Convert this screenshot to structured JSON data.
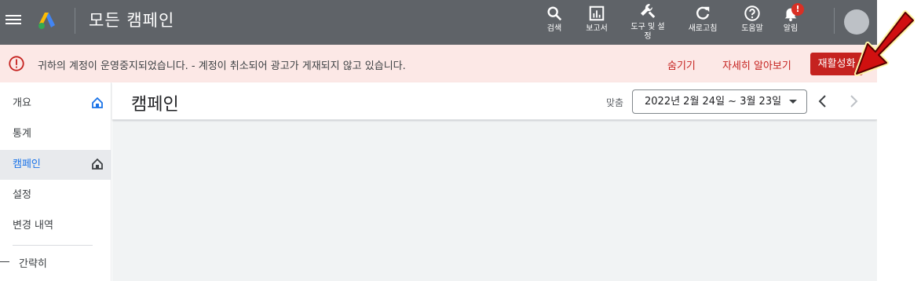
{
  "topbar": {
    "menu_icon": "hamburger-menu-icon",
    "logo_icon": "google-ads-logo-icon",
    "title": "모든 캠페인",
    "tools": [
      {
        "label": "검색",
        "icon": "search-icon"
      },
      {
        "label": "보고서",
        "icon": "reports-icon"
      },
      {
        "label": "도구 및 설",
        "label2": "정",
        "icon": "wrench-icon"
      },
      {
        "label": "새로고침",
        "icon": "refresh-icon"
      },
      {
        "label": "도움말",
        "icon": "help-icon"
      },
      {
        "label": "알림",
        "icon": "bell-icon",
        "badge": "!"
      }
    ],
    "bg_color": "#5f6368"
  },
  "alert": {
    "icon": "error-icon",
    "message": "귀하의 계정이 운영중지되었습니다. - 계정이 취소되어 광고가 게재되지 않고 있습니다.",
    "hide_label": "숨기기",
    "learn_more_label": "자세히 알아보기",
    "reactivate_label": "재활성화",
    "bg_color": "#fce8e6",
    "accent_color": "#c5221f"
  },
  "sidebar": {
    "items": [
      {
        "label": "개요",
        "icon": "home-icon"
      },
      {
        "label": "통계"
      },
      {
        "label": "캠페인",
        "icon": "home-icon",
        "active": true
      },
      {
        "label": "설정"
      },
      {
        "label": "변경 내역"
      }
    ],
    "compact_label": "간략히"
  },
  "main": {
    "title": "캠페인",
    "date_label": "맞춤",
    "date_range": "2022년 2월 24일 ~ 3월 23일"
  }
}
